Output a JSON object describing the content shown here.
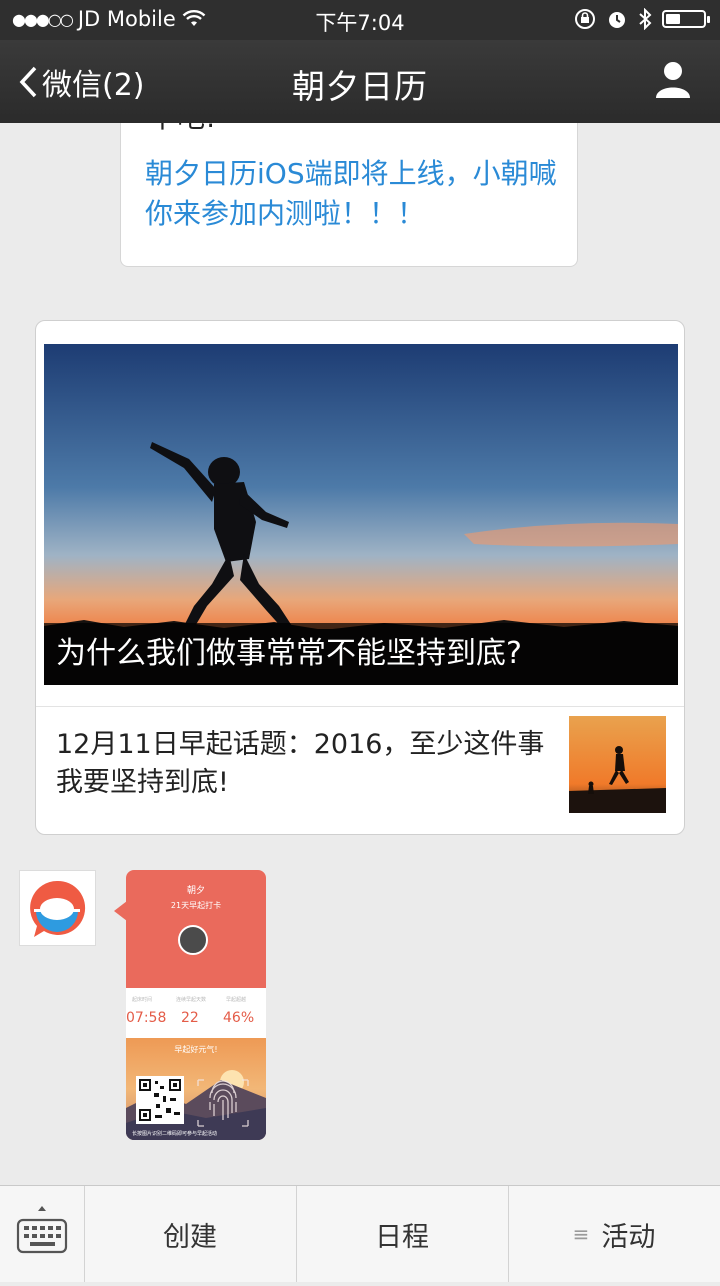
{
  "status_bar": {
    "carrier": "JD Mobile",
    "time": "下午7:04",
    "signal_icon": "signal-dots-icon",
    "wifi_icon": "wifi-icon",
    "battery_level": 0.35
  },
  "nav": {
    "back_label": "微信(2)",
    "title": "朝夕日历"
  },
  "messages": {
    "top_bubble_cut_text": "下吧!",
    "top_bubble_text": "朝夕日历iOS端即将上线，小朝喊你来参加内测啦！！！",
    "article": {
      "cover_caption": "为什么我们做事常常不能坚持到底?",
      "sub_title": "12月11日早起话题：2016，至少这件事我要坚持到底!"
    },
    "image_card": {
      "name": "朝夕",
      "subtitle": "21天早起打卡",
      "stats": [
        {
          "label": "起床时间",
          "value": "07:58"
        },
        {
          "label": "连续早起天数",
          "value": "22"
        },
        {
          "label": "早起超越",
          "value": "46%"
        }
      ],
      "scene_text": "早起好元气!",
      "footer": "长按图片识别二维码即可参与早起活动"
    }
  },
  "tabbar": {
    "keyboard_icon": "keyboard-icon",
    "tabs": [
      {
        "label": "创建"
      },
      {
        "label": "日程"
      },
      {
        "label": "活动",
        "has_menu_icon": true
      }
    ]
  },
  "colors": {
    "link_blue": "#2a8ad6",
    "brand_red": "#ea6a5c",
    "nav_bg": "#2f2f2f"
  }
}
